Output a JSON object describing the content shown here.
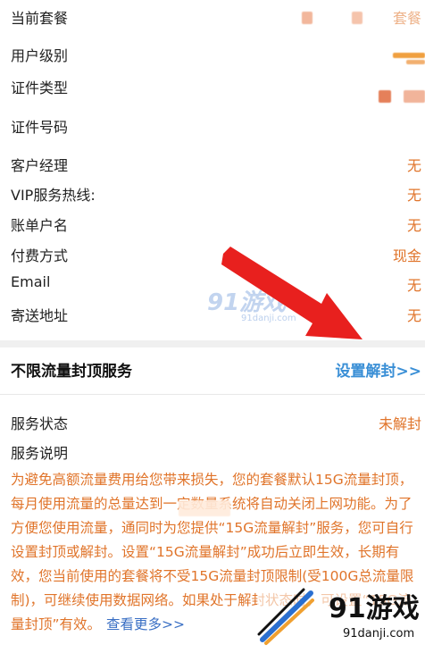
{
  "info_rows": [
    {
      "label": "当前套餐",
      "value": "套餐"
    },
    {
      "label": "用户级别",
      "value": ""
    },
    {
      "label": "证件类型",
      "value": ""
    },
    {
      "label": "证件号码",
      "value": ""
    },
    {
      "label": "客户经理",
      "value": "无"
    },
    {
      "label": "VIP服务热线:",
      "value": "无"
    },
    {
      "label": "账单户名",
      "value": "无"
    },
    {
      "label": "付费方式",
      "value": "现金"
    },
    {
      "label": "Email",
      "value": "无"
    },
    {
      "label": "寄送地址",
      "value": "无"
    }
  ],
  "section": {
    "title": "不限流量封顶服务",
    "link": "设置解封>>"
  },
  "service_rows": [
    {
      "label": "服务状态",
      "value": "未解封"
    },
    {
      "label": "服务说明",
      "value": ""
    }
  ],
  "description": {
    "text": "为避免高额流量费用给您带来损失，您的套餐默认15G流量封顶，每月使用流量的总量达到一定数量系统将自动关闭上网功能。为了方便您使用流量，通同时为您提供“15G流量解封”服务，您可自行设置封顶或解封。设置“15G流量解封”成功后立即生效，长期有效，您当前使用的套餐将不受15G流量封顶限制(受100G总流量限制)，可继续使用数据网络。如果处于解封状态时，可设置“15G流量封顶”有效。",
    "more": "查看更多>>"
  },
  "watermarks": {
    "center": "91游戏",
    "center_url": "91danji.com",
    "corner": "91游戏",
    "corner_url": "91danji.com"
  },
  "colors": {
    "accent_orange": "#e0742a",
    "link_blue": "#3a8fd6",
    "arrow_red": "#e8201e"
  }
}
